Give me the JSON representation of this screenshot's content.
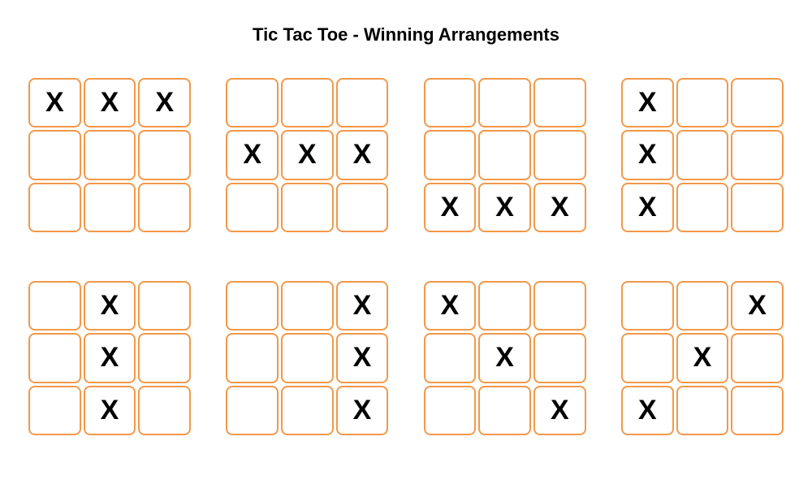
{
  "title": "Tic Tac Toe - Winning Arrangements",
  "mark": "X",
  "boards": [
    {
      "cells": [
        "X",
        "X",
        "X",
        "",
        "",
        "",
        "",
        "",
        ""
      ]
    },
    {
      "cells": [
        "",
        "",
        "",
        "X",
        "X",
        "X",
        "",
        "",
        ""
      ]
    },
    {
      "cells": [
        "",
        "",
        "",
        "",
        "",
        "",
        "X",
        "X",
        "X"
      ]
    },
    {
      "cells": [
        "X",
        "",
        "",
        "X",
        "",
        "",
        "X",
        "",
        ""
      ]
    },
    {
      "cells": [
        "",
        "X",
        "",
        "",
        "X",
        "",
        "",
        "X",
        ""
      ]
    },
    {
      "cells": [
        "",
        "",
        "X",
        "",
        "",
        "X",
        "",
        "",
        "X"
      ]
    },
    {
      "cells": [
        "X",
        "",
        "",
        "",
        "X",
        "",
        "",
        "",
        "X"
      ]
    },
    {
      "cells": [
        "",
        "",
        "X",
        "",
        "X",
        "",
        "X",
        "",
        ""
      ]
    }
  ]
}
